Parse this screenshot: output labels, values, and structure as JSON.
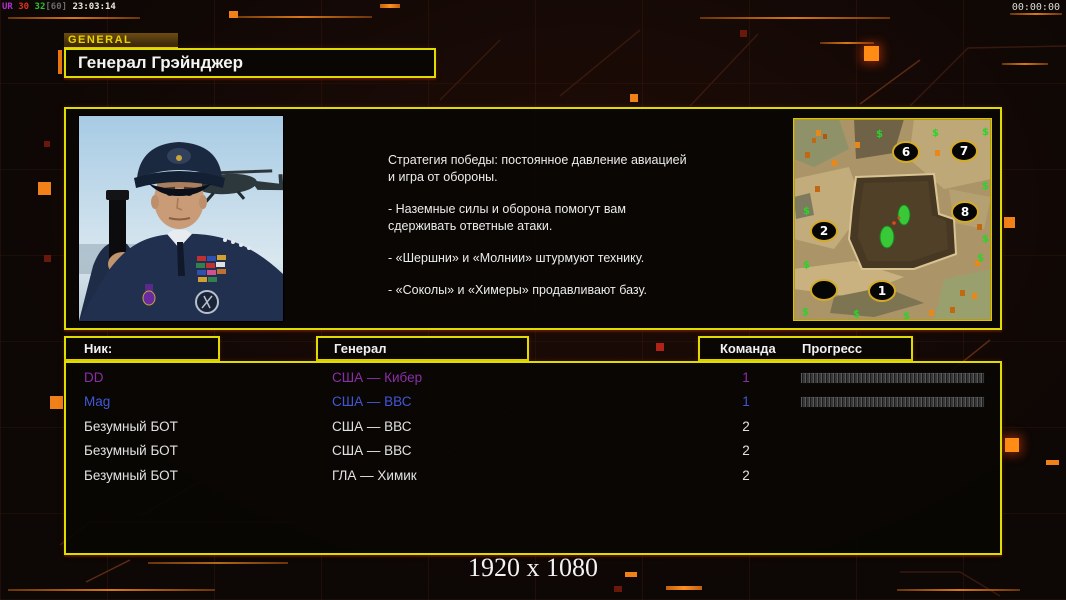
{
  "hud": {
    "debug": {
      "ur": "UR",
      "fps": "30",
      "fps2": "32",
      "cap": "[60]",
      "clock": "23:03:14"
    },
    "timer": "00:00:00"
  },
  "header": {
    "tab_label": "GENERAL",
    "title": "Генерал Грэйнджер"
  },
  "briefing": {
    "paragraphs": [
      "Стратегия победы: постоянное давление авиацией\n и игра от обороны.",
      "- Наземные силы и оборона помогут вам\n сдерживать ответные атаки.",
      "- «Шершни» и «Молнии» штурмуют технику.",
      "- «Соколы» и «Химеры» продавливают базу."
    ]
  },
  "minimap": {
    "supply_symbol": "$",
    "markers": [
      {
        "label": "6"
      },
      {
        "label": "7"
      },
      {
        "label": "8"
      },
      {
        "label": "2"
      },
      {
        "label": "1"
      },
      {
        "label": ""
      }
    ]
  },
  "table": {
    "headers": {
      "nick": "Ник:",
      "general": "Генерал",
      "team": "Команда",
      "progress": "Прогресс"
    },
    "rows": [
      {
        "nick": "DD",
        "general": "США — Кибер",
        "team": "1",
        "color": "#8b2fa8",
        "has_progress": true
      },
      {
        "nick": "Mag",
        "general": "США — ВВС",
        "team": "1",
        "color": "#4157d8",
        "has_progress": true
      },
      {
        "nick": "Безумный БОТ",
        "general": "США — ВВС",
        "team": "2",
        "color": "#e2e2e2",
        "has_progress": false
      },
      {
        "nick": "Безумный БОТ",
        "general": "США — ВВС",
        "team": "2",
        "color": "#e2e2e2",
        "has_progress": false
      },
      {
        "nick": "Безумный БОТ",
        "general": "ГЛА — Химик",
        "team": "2",
        "color": "#e2e2e2",
        "has_progress": false
      }
    ]
  },
  "footer": {
    "resolution": "1920 x 1080"
  },
  "colors": {
    "accent_yellow": "#dedc00",
    "accent_orange": "#f08018"
  }
}
